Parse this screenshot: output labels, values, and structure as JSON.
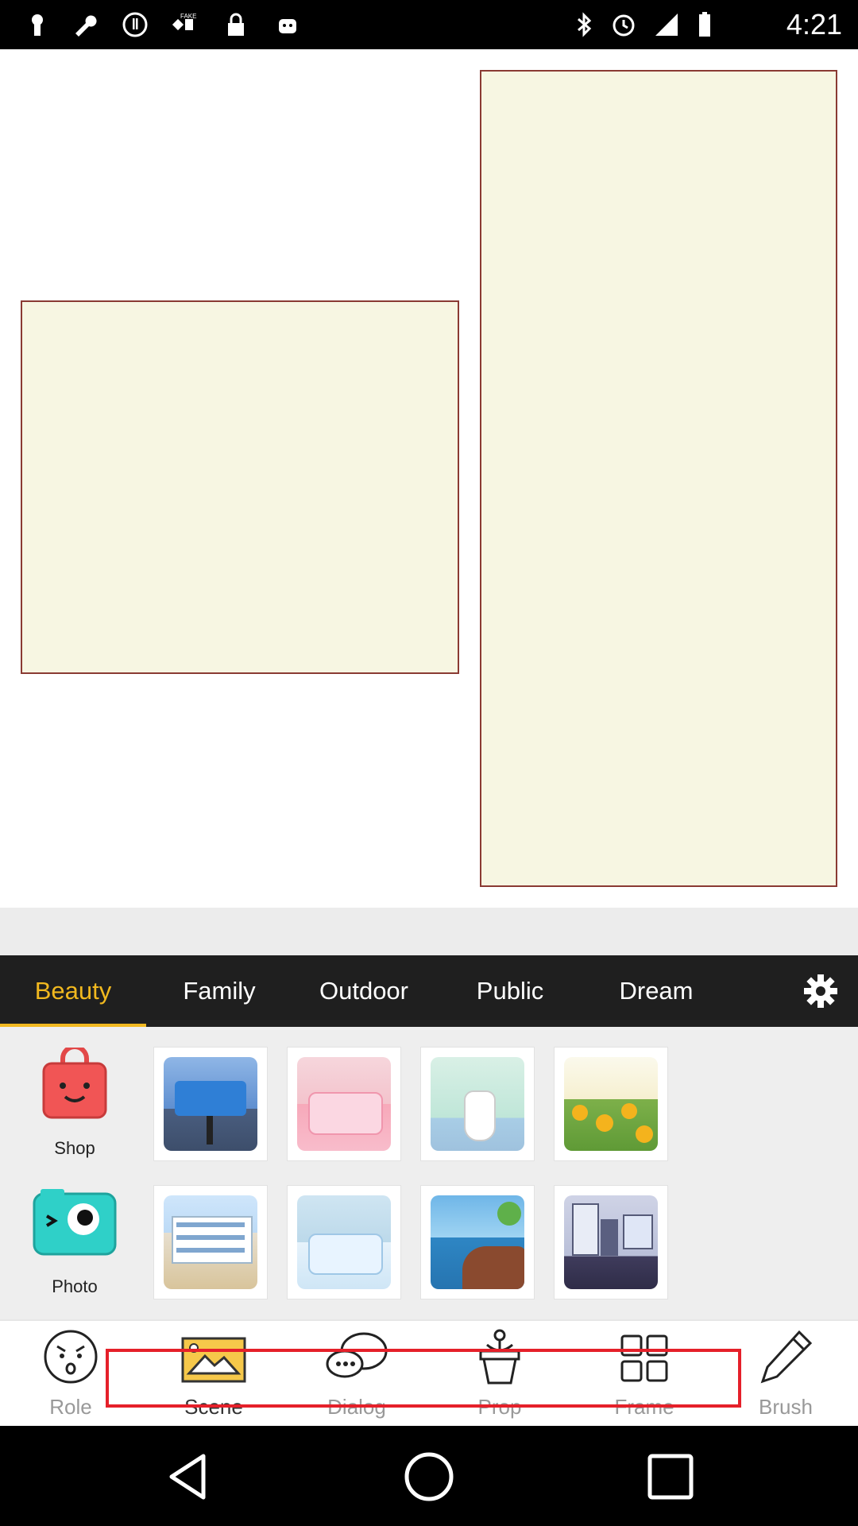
{
  "status_bar": {
    "time": "4:21",
    "left_icons": [
      "keyhole-icon",
      "wrench-icon",
      "sync-icon",
      "satellite-icon",
      "lock-icon",
      "android-icon"
    ],
    "right_icons": [
      "bluetooth-icon",
      "alarm-icon",
      "signal-icon",
      "battery-icon"
    ]
  },
  "canvas": {
    "panels": [
      "left-panel",
      "right-panel"
    ],
    "panel_fill": "#f7f6e2",
    "panel_border": "#8a3a33"
  },
  "categories": {
    "tabs": [
      {
        "label": "Beauty",
        "active": true
      },
      {
        "label": "Family",
        "active": false
      },
      {
        "label": "Outdoor",
        "active": false
      },
      {
        "label": "Public",
        "active": false
      },
      {
        "label": "Dream",
        "active": false
      }
    ],
    "settings_icon": "gear-icon",
    "accent_color": "#f1b81f"
  },
  "side_buttons": {
    "shop": "Shop",
    "photo": "Photo"
  },
  "scenes": [
    {
      "name": "waiting-bench-scene"
    },
    {
      "name": "pink-bedroom-scene"
    },
    {
      "name": "bathroom-scene"
    },
    {
      "name": "sunflower-field-scene"
    },
    {
      "name": "school-building-scene"
    },
    {
      "name": "blue-bedroom-scene"
    },
    {
      "name": "seaside-cliff-scene"
    },
    {
      "name": "hallway-scene"
    }
  ],
  "tools": [
    {
      "label": "Role",
      "icon": "face-icon",
      "active": false
    },
    {
      "label": "Scene",
      "icon": "picture-icon",
      "active": true
    },
    {
      "label": "Dialog",
      "icon": "speech-bubble-icon",
      "active": false
    },
    {
      "label": "Prop",
      "icon": "potted-plant-icon",
      "active": false
    },
    {
      "label": "Frame",
      "icon": "grid-icon",
      "active": false
    },
    {
      "label": "Brush",
      "icon": "pencil-icon",
      "active": false
    }
  ],
  "navigation": [
    "back-icon",
    "home-icon",
    "recents-icon"
  ]
}
